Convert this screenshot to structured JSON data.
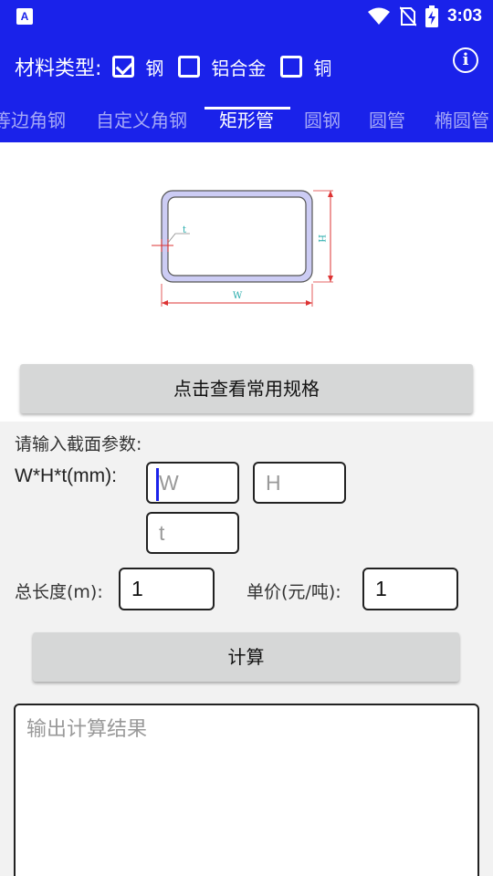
{
  "status": {
    "app_icon": "A",
    "time": "3:03",
    "icons": [
      "wifi-icon",
      "no-sim-icon",
      "battery-charging-icon"
    ]
  },
  "appbar": {
    "material_label": "材料类型:",
    "materials": [
      {
        "label": "钢",
        "checked": true
      },
      {
        "label": "铝合金",
        "checked": false
      },
      {
        "label": "铜",
        "checked": false
      }
    ],
    "info_icon": "info-icon"
  },
  "tabs": [
    {
      "label": "等边角钢",
      "active": false
    },
    {
      "label": "自定义角钢",
      "active": false
    },
    {
      "label": "矩形管",
      "active": true
    },
    {
      "label": "圆钢",
      "active": false
    },
    {
      "label": "圆管",
      "active": false
    },
    {
      "label": "椭圆管",
      "active": false
    }
  ],
  "diagram": {
    "t_label": "t",
    "h_label": "H",
    "w_label": "W"
  },
  "spec_button": "点击查看常用规格",
  "form": {
    "prompt": "请输入截面参数:",
    "wht_label": "W*H*t(mm):",
    "w_placeholder": "W",
    "h_placeholder": "H",
    "t_placeholder": "t",
    "length_label": "总长度(m):",
    "length_value": "1",
    "price_label": "单价(元/吨):",
    "price_value": "1"
  },
  "calc_button": "计算",
  "output_placeholder": "输出计算结果",
  "colors": {
    "accent": "#1a22ea",
    "button": "#d6d7d7",
    "form_bg": "#f2f2f2"
  }
}
